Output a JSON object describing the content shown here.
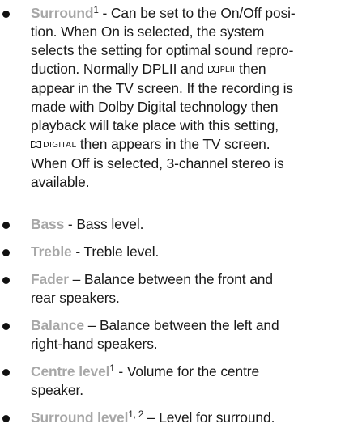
{
  "items": [
    {
      "term": "Surround",
      "sup": "1",
      "p1": " - Can be set to the On/Off posi-",
      "p2": "tion. When On is selected, the system",
      "p3": "selects the setting for optimal sound repro-",
      "p4a": "duction. Normally DPLII and ",
      "logo_pl": "PLII",
      "p4b": " then",
      "p5": "appear in the TV screen. If the recording is",
      "p6": "made with Dolby Digital technology then",
      "p7": "playback will take place with this setting,",
      "logo_digital": "DIGITAL",
      "p8b": " then appears in the TV screen.",
      "p9": "When Off is selected, 3-channel stereo is",
      "p10": "available."
    },
    {
      "term": "Bass",
      "desc": " - Bass level."
    },
    {
      "term": "Treble",
      "desc": " - Treble level."
    },
    {
      "term": "Fader",
      "desc1": " – Balance between the front and",
      "desc2": "rear speakers."
    },
    {
      "term": "Balance",
      "desc1": " – Balance between the left and",
      "desc2": "right-hand speakers."
    },
    {
      "term": "Centre level",
      "sup": "1",
      "desc1": " - Volume for the centre",
      "desc2": "speaker."
    },
    {
      "term": "Surround level",
      "sup": "1, 2",
      "desc": " – Level for surround."
    }
  ]
}
